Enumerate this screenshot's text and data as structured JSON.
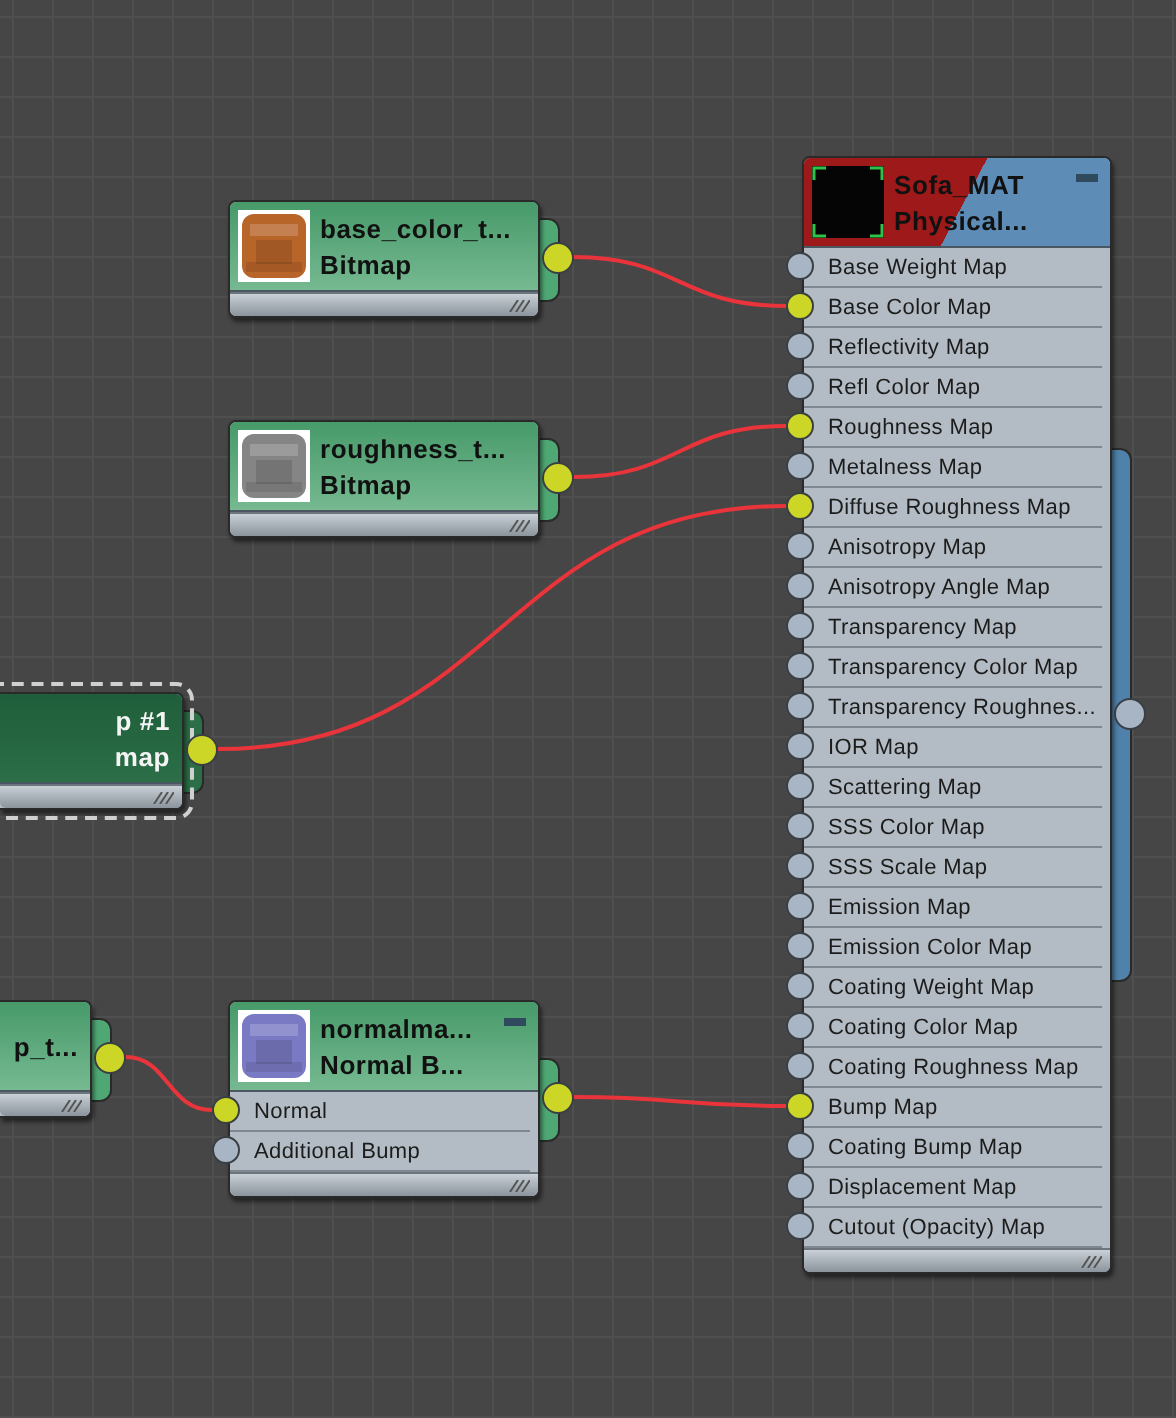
{
  "nodes": [
    {
      "title": "base_color_t...",
      "subtitle": "Bitmap",
      "selected": false,
      "minimize": false,
      "thumbnail": {
        "kind": "texture",
        "color": "#b8652a"
      },
      "output": {
        "connected": true
      }
    },
    {
      "title": "roughness_t...",
      "subtitle": "Bitmap",
      "selected": false,
      "minimize": false,
      "thumbnail": {
        "kind": "texture",
        "color": "#858585"
      },
      "output": {
        "connected": true
      }
    },
    {
      "title": "p #1",
      "subtitle": "map",
      "selected": true,
      "minimize": false,
      "output": {
        "connected": true
      }
    },
    {
      "title": "p_t...",
      "selected": false,
      "minimize": false,
      "output": {
        "connected": true
      }
    },
    {
      "title": "normalma...",
      "subtitle": "Normal  B...",
      "selected": false,
      "minimize": true,
      "thumbnail": {
        "kind": "texture",
        "color": "#7a7ac4"
      },
      "inputs": [
        {
          "label": "Normal",
          "connected": true
        },
        {
          "label": "Additional Bump",
          "connected": false
        }
      ],
      "output": {
        "connected": true
      }
    },
    {
      "title": "Sofa_MAT",
      "subtitle": "Physical...",
      "selected": false,
      "minimize": true,
      "thumbnail": {
        "kind": "swatch",
        "color": "#050505"
      },
      "inputs": [
        {
          "label": "Base Weight Map",
          "connected": false
        },
        {
          "label": "Base Color Map",
          "connected": true
        },
        {
          "label": "Reflectivity Map",
          "connected": false
        },
        {
          "label": "Refl Color Map",
          "connected": false
        },
        {
          "label": "Roughness Map",
          "connected": true
        },
        {
          "label": "Metalness Map",
          "connected": false
        },
        {
          "label": "Diffuse Roughness Map",
          "connected": true
        },
        {
          "label": "Anisotropy Map",
          "connected": false
        },
        {
          "label": "Anisotropy Angle Map",
          "connected": false
        },
        {
          "label": "Transparency Map",
          "connected": false
        },
        {
          "label": "Transparency Color Map",
          "connected": false
        },
        {
          "label": "Transparency Roughnes...",
          "connected": false
        },
        {
          "label": "IOR Map",
          "connected": false
        },
        {
          "label": "Scattering Map",
          "connected": false
        },
        {
          "label": "SSS Color Map",
          "connected": false
        },
        {
          "label": "SSS Scale Map",
          "connected": false
        },
        {
          "label": "Emission Map",
          "connected": false
        },
        {
          "label": "Emission Color Map",
          "connected": false
        },
        {
          "label": "Coating Weight Map",
          "connected": false
        },
        {
          "label": "Coating Color Map",
          "connected": false
        },
        {
          "label": "Coating Roughness Map",
          "connected": false
        },
        {
          "label": "Bump Map",
          "connected": true
        },
        {
          "label": "Coating Bump Map",
          "connected": false
        },
        {
          "label": "Displacement Map",
          "connected": false
        },
        {
          "label": "Cutout (Opacity) Map",
          "connected": false
        }
      ],
      "output": {
        "connected": false
      }
    }
  ]
}
